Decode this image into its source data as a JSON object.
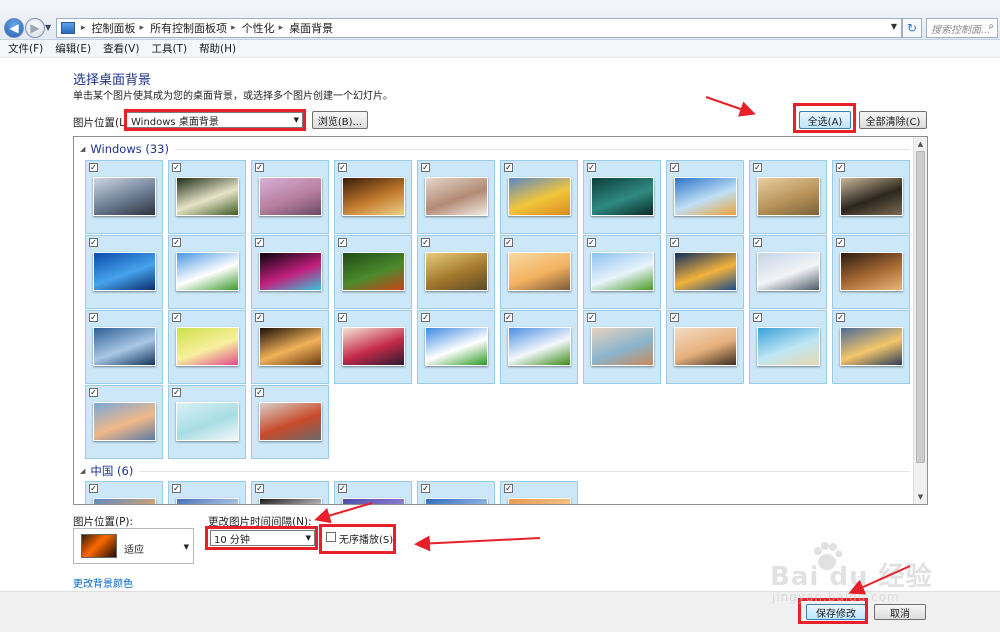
{
  "address": {
    "breadcrumbs": [
      "控制面板",
      "所有控制面板项",
      "个性化",
      "桌面背景"
    ],
    "search_placeholder": "搜索控制面..."
  },
  "menu": [
    "文件(F)",
    "编辑(E)",
    "查看(V)",
    "工具(T)",
    "帮助(H)"
  ],
  "page": {
    "title": "选择桌面背景",
    "subtitle": "单击某个图片使其成为您的桌面背景，或选择多个图片创建一个幻灯片。"
  },
  "location": {
    "label": "图片位置(L):",
    "value": "Windows 桌面背景",
    "browse_label": "浏览(B)...",
    "select_all_label": "全选(A)",
    "clear_all_label": "全部清除(C)"
  },
  "groups": [
    {
      "name": "Windows (33)",
      "tiles": [
        {
          "checked": true,
          "colors": [
            "#cdd7e4",
            "#6c7c92",
            "#2d3340"
          ]
        },
        {
          "checked": true,
          "colors": [
            "#1e2e18",
            "#e8e4c8",
            "#3f5a26"
          ]
        },
        {
          "checked": true,
          "colors": [
            "#d7b0d8",
            "#b77e9e",
            "#6a4a66"
          ]
        },
        {
          "checked": true,
          "colors": [
            "#3a1c08",
            "#c27a2e",
            "#ecd18a"
          ]
        },
        {
          "checked": true,
          "colors": [
            "#e4d6cc",
            "#b38a74",
            "#f2ece6"
          ]
        },
        {
          "checked": true,
          "colors": [
            "#5a88c6",
            "#f2c63a",
            "#d88a20"
          ]
        },
        {
          "checked": true,
          "colors": [
            "#0d3e3a",
            "#2f8a82",
            "#0b2926"
          ]
        },
        {
          "checked": true,
          "colors": [
            "#2d73c8",
            "#bfe0f6",
            "#e9a238"
          ]
        },
        {
          "checked": true,
          "colors": [
            "#e8cfa0",
            "#b8935a",
            "#7c6238"
          ]
        },
        {
          "checked": true,
          "colors": [
            "#c8b89a",
            "#2c261e",
            "#7a6a52"
          ]
        },
        {
          "checked": true,
          "colors": [
            "#0c4cae",
            "#46a3ec",
            "#0a2c6c"
          ]
        },
        {
          "checked": true,
          "colors": [
            "#4c96e2",
            "#ffffff",
            "#3c9a2a"
          ]
        },
        {
          "checked": true,
          "colors": [
            "#08040e",
            "#c2207e",
            "#34c6d8"
          ]
        },
        {
          "checked": true,
          "colors": [
            "#1e4a16",
            "#4c8a2c",
            "#c8441c"
          ]
        },
        {
          "checked": true,
          "colors": [
            "#e6cc7a",
            "#a4782c",
            "#5a4a2a"
          ]
        },
        {
          "checked": true,
          "colors": [
            "#f6d8a4",
            "#f4b260",
            "#7a5a3a"
          ]
        },
        {
          "checked": true,
          "colors": [
            "#8ec0f0",
            "#e8f4fa",
            "#4a9a24"
          ]
        },
        {
          "checked": true,
          "colors": [
            "#0e2e5e",
            "#f2b23c",
            "#1c4a86"
          ]
        },
        {
          "checked": true,
          "colors": [
            "#c4d4e4",
            "#f2f4f8",
            "#4e5a66"
          ]
        },
        {
          "checked": true,
          "colors": [
            "#2c1c10",
            "#a86a34",
            "#e8b67a"
          ]
        },
        {
          "checked": true,
          "colors": [
            "#2e5e96",
            "#a8c8e6",
            "#14345c"
          ]
        },
        {
          "checked": true,
          "colors": [
            "#cce04a",
            "#f8f0a0",
            "#e04a8a"
          ]
        },
        {
          "checked": true,
          "colors": [
            "#1a1008",
            "#f2b25a",
            "#6a3a14"
          ]
        },
        {
          "checked": true,
          "colors": [
            "#f4e4d4",
            "#c42a4a",
            "#2a1a30"
          ]
        },
        {
          "checked": true,
          "colors": [
            "#3c8ae0",
            "#ffffff",
            "#2c9a22"
          ]
        },
        {
          "checked": true,
          "colors": [
            "#4a8ee2",
            "#f4f8fc",
            "#3c8a1c"
          ]
        },
        {
          "checked": true,
          "colors": [
            "#e6d2c0",
            "#8ab4cc",
            "#c88a5a"
          ]
        },
        {
          "checked": true,
          "colors": [
            "#f2dcc4",
            "#e6b07c",
            "#3c2c20"
          ]
        },
        {
          "checked": true,
          "colors": [
            "#3ca0d8",
            "#bfe6f4",
            "#e8d8b0"
          ]
        },
        {
          "checked": true,
          "colors": [
            "#4a6a9a",
            "#f4c66a",
            "#2c3c5a"
          ]
        },
        {
          "checked": true,
          "colors": [
            "#7aa8d8",
            "#f0b888",
            "#5a7aa4"
          ]
        },
        {
          "checked": true,
          "colors": [
            "#d8f0f4",
            "#a8dce4",
            "#f4f8f8"
          ]
        },
        {
          "checked": true,
          "colors": [
            "#d8d0c8",
            "#c84a2a",
            "#6a6a6a"
          ]
        }
      ]
    },
    {
      "name": "中国 (6)",
      "tiles": [
        {
          "checked": true,
          "colors": [
            "#5a88c6",
            "#e8a860",
            "#c86a30"
          ]
        },
        {
          "checked": true,
          "colors": [
            "#4070b8",
            "#c8d8e8",
            "#8ca0b8"
          ]
        },
        {
          "checked": true,
          "colors": [
            "#1a1a1a",
            "#d8d8d8",
            "#707070"
          ]
        },
        {
          "checked": true,
          "colors": [
            "#4a4aa8",
            "#9a8ad8",
            "#d8c8f0"
          ]
        },
        {
          "checked": true,
          "colors": [
            "#2a68c0",
            "#a8c8e8",
            "#e8f0f8"
          ]
        },
        {
          "checked": true,
          "colors": [
            "#e89850",
            "#f4c890",
            "#b86830"
          ]
        }
      ]
    }
  ],
  "position": {
    "label": "图片位置(P):",
    "value": "适应"
  },
  "interval": {
    "label": "更改图片时间间隔(N):",
    "value": "10 分钟",
    "shuffle_label": "无序播放(S)",
    "shuffle_checked": false
  },
  "change_color_link": "更改背景颜色",
  "footer": {
    "save_label": "保存修改",
    "cancel_label": "取消"
  },
  "watermark": {
    "text": "Bai du 经验",
    "url": "jingyan.baidu.com"
  },
  "colors": {
    "accent_red": "#e8202a",
    "heading_blue": "#1e3287",
    "tile_selected": "#cce8f8",
    "link_blue": "#0066cc"
  },
  "icons": {
    "back": "back-arrow-icon",
    "forward": "forward-arrow-icon",
    "refresh": "refresh-icon",
    "search": "search-icon",
    "checkbox": "checkmark-icon",
    "expand": "collapse-triangle-icon"
  }
}
